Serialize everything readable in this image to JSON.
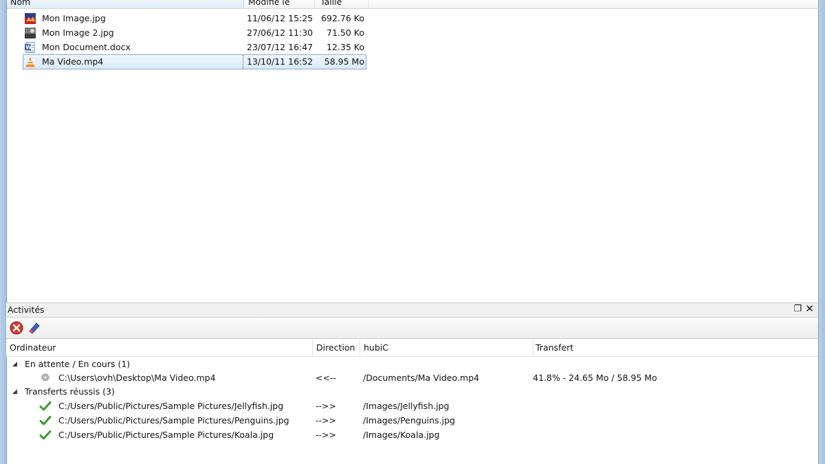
{
  "file_list": {
    "columns": {
      "name": "Nom",
      "modified": "Modifié le",
      "size": "Taille"
    },
    "rows": [
      {
        "icon": "image-icon",
        "name": "Mon Image.jpg",
        "modified": "11/06/12 15:25",
        "size": "692.76 Ko"
      },
      {
        "icon": "image-icon",
        "name": "Mon Image 2.jpg",
        "modified": "27/06/12 11:30",
        "size": "71.50 Ko"
      },
      {
        "icon": "word-document-icon",
        "name": "Mon Document.docx",
        "modified": "23/07/12 16:47",
        "size": "12.35 Ko"
      },
      {
        "icon": "vlc-video-icon",
        "name": "Ma Video.mp4",
        "modified": "13/10/11 16:52",
        "size": "58.95 Mo"
      }
    ]
  },
  "activities": {
    "title": "Activités",
    "columns": {
      "computer": "Ordinateur",
      "direction": "Direction",
      "hubic": "hubiC",
      "transfer": "Transfert"
    },
    "groups": [
      {
        "label": "En attente / En cours (1)",
        "items": [
          {
            "icon": "gear-icon",
            "path": "C:\\Users\\ovh\\Desktop\\Ma Video.mp4",
            "direction": "<<--",
            "remote": "/Documents/Ma Video.mp4",
            "transfer": "41.8% - 24.65 Mo / 58.95 Mo"
          }
        ]
      },
      {
        "label": "Transferts réussis (3)",
        "items": [
          {
            "icon": "check-icon",
            "path": "C:/Users/Public/Pictures/Sample Pictures/Jellyfish.jpg",
            "direction": "-->>",
            "remote": "/Images/Jellyfish.jpg",
            "transfer": ""
          },
          {
            "icon": "check-icon",
            "path": "C:/Users/Public/Pictures/Sample Pictures/Penguins.jpg",
            "direction": "-->>",
            "remote": "/Images/Penguins.jpg",
            "transfer": ""
          },
          {
            "icon": "check-icon",
            "path": "C:/Users/Public/Pictures/Sample Pictures/Koala.jpg",
            "direction": "-->>",
            "remote": "/Images/Koala.jpg",
            "transfer": ""
          }
        ]
      }
    ]
  },
  "colors": {
    "selection_border": "#84acdd",
    "check_green": "#3a9a2a",
    "cancel_red": "#d9382e"
  }
}
